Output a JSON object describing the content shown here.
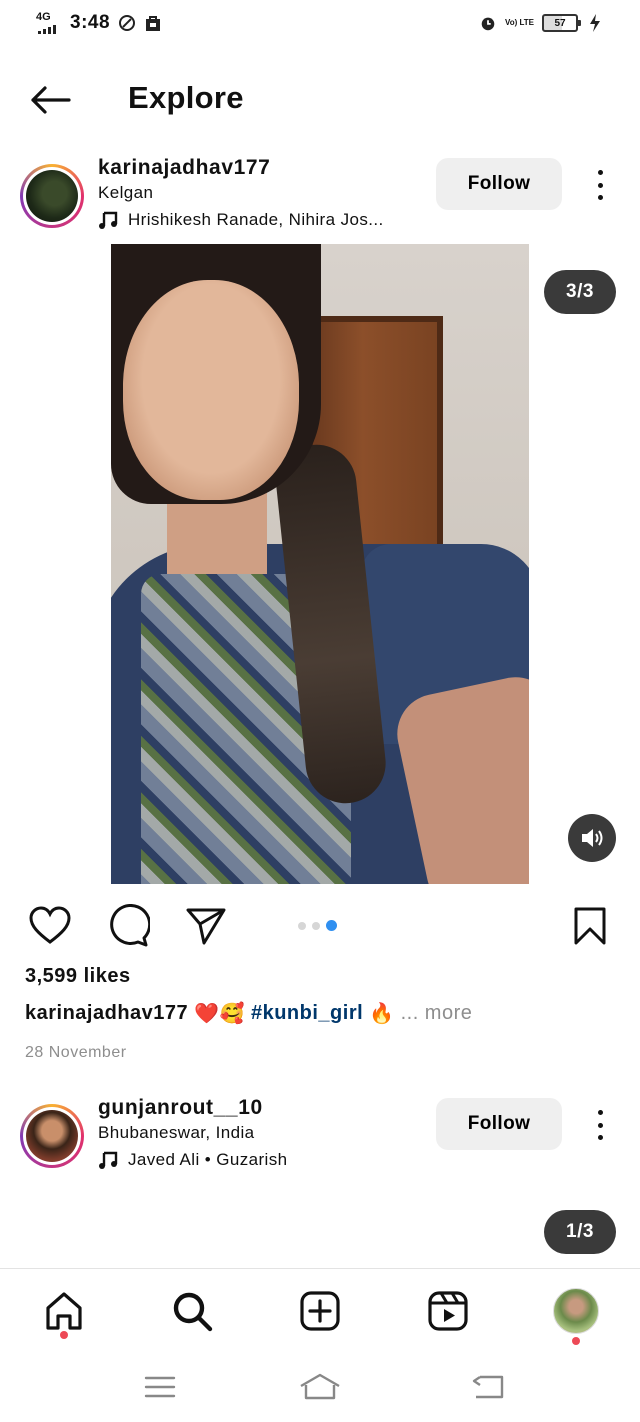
{
  "status_bar": {
    "network": "4G",
    "time": "3:48",
    "volte": "Vo) LTE",
    "battery": "57"
  },
  "header": {
    "title": "Explore",
    "back_icon": "arrow-left-icon"
  },
  "posts": [
    {
      "username": "karinajadhav177",
      "location": "Kelgan",
      "music": "Hrishikesh Ranade, Nihira Jos...",
      "follow_label": "Follow",
      "counter": "3/3",
      "likes": "3,599 likes",
      "caption_user": "karinajadhav177",
      "caption_emojis": "❤️🥰",
      "caption_tag": "#kunbi_girl",
      "caption_emoji_end": "🔥",
      "caption_more": "... more",
      "date": "28 November",
      "carousel_total": 3,
      "carousel_active": 3
    },
    {
      "username": "gunjanrout__10",
      "location": "Bhubaneswar, India",
      "music": "Javed Ali • Guzarish",
      "follow_label": "Follow",
      "counter": "1/3"
    }
  ],
  "bottom_nav": {
    "items": [
      "home-icon",
      "search-icon",
      "create-icon",
      "reels-icon",
      "profile-avatar"
    ],
    "active": "search-icon"
  },
  "colors": {
    "hashtag": "#00376b",
    "carousel_active": "#2f8ff0",
    "notification": "#ed4956",
    "badge_bg": "#3a3a3a",
    "follow_bg": "#efefef"
  }
}
